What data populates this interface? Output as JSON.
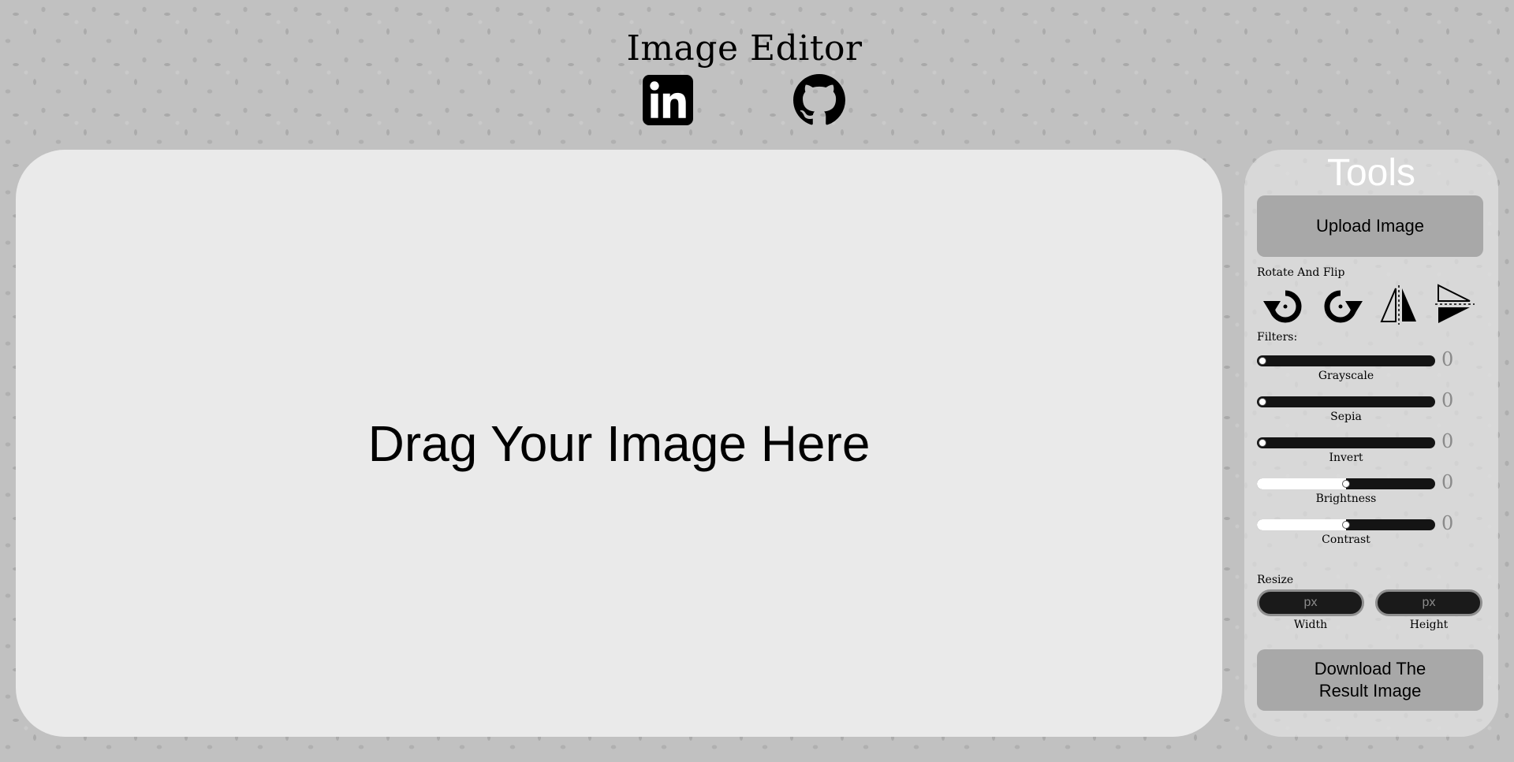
{
  "header": {
    "title": "Image Editor",
    "links": [
      {
        "icon": "linkedin-icon"
      },
      {
        "icon": "github-icon"
      }
    ]
  },
  "drop_zone": {
    "text": "Drag Your Image Here"
  },
  "tools": {
    "title": "Tools",
    "upload_label": "Upload Image",
    "rotate_label": "Rotate And Flip",
    "rotate_buttons": [
      "rotate-left-icon",
      "rotate-right-icon",
      "flip-horizontal-icon",
      "flip-vertical-icon"
    ],
    "filters_label": "Filters:",
    "filters": [
      {
        "label": "Grayscale",
        "value": "0",
        "position": 0
      },
      {
        "label": "Sepia",
        "value": "0",
        "position": 0
      },
      {
        "label": "Invert",
        "value": "0",
        "position": 0
      },
      {
        "label": "Brightness",
        "value": "0",
        "position": 0.5
      },
      {
        "label": "Contrast",
        "value": "0",
        "position": 0.5
      }
    ],
    "resize_label": "Resize",
    "resize": {
      "width": {
        "placeholder": "px",
        "caption": "Width"
      },
      "height": {
        "placeholder": "px",
        "caption": "Height"
      }
    },
    "download_label": "Download The\nResult Image"
  },
  "colors": {
    "background": "#c1c1c1",
    "drop_zone": "#eaeaea",
    "button": "#a8a8a8",
    "slider_track": "#141414"
  }
}
